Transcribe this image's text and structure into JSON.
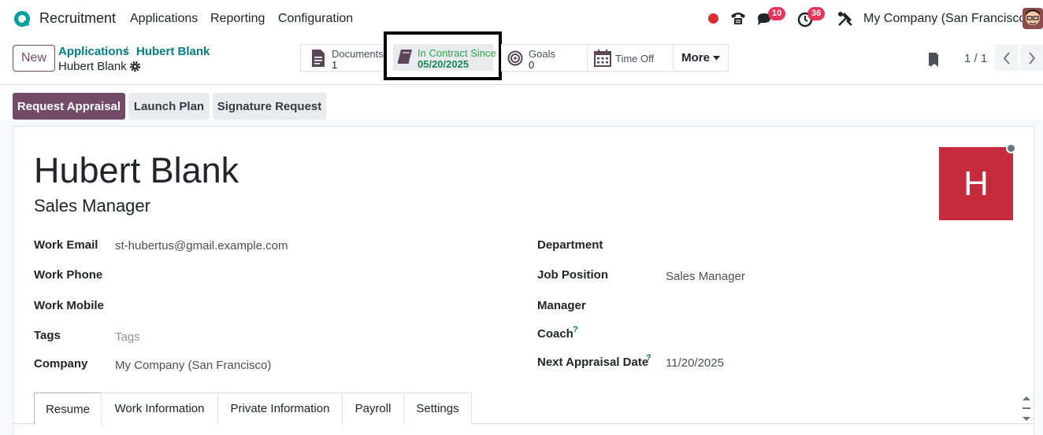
{
  "navbar": {
    "app_name": "Recruitment",
    "menus": [
      "Applications",
      "Reporting",
      "Configuration"
    ],
    "chat_count": "10",
    "activity_count": "36",
    "company": "My Company (San Francisco)"
  },
  "control": {
    "new_label": "New",
    "breadcrumb": [
      "Applications",
      "Hubert Blank"
    ],
    "record_name": "Hubert Blank",
    "smart_buttons": {
      "documents_label": "Documents",
      "documents_value": "1",
      "contract_label": "In Contract Since",
      "contract_value": "05/20/2025",
      "goals_label": "Goals",
      "goals_value": "0",
      "timeoff_label": "Time Off",
      "more_label": "More"
    },
    "pager": "1 / 1"
  },
  "actions": {
    "request_appraisal": "Request Appraisal",
    "launch_plan": "Launch Plan",
    "signature_request": "Signature Request"
  },
  "employee": {
    "name": "Hubert Blank",
    "job_title": "Sales Manager",
    "avatar_letter": "H"
  },
  "fields": {
    "work_email_label": "Work Email",
    "work_email": "st-hubertus@gmail.example.com",
    "work_phone_label": "Work Phone",
    "work_mobile_label": "Work Mobile",
    "tags_label": "Tags",
    "tags_placeholder": "Tags",
    "company_label": "Company",
    "company": "My Company (San Francisco)",
    "department_label": "Department",
    "job_position_label": "Job Position",
    "job_position": "Sales Manager",
    "manager_label": "Manager",
    "coach_label": "Coach",
    "next_appraisal_label": "Next Appraisal Date",
    "next_appraisal": "11/20/2025",
    "help_mark": "?"
  },
  "tabs": [
    "Resume",
    "Work Information",
    "Private Information",
    "Payroll",
    "Settings"
  ],
  "colors": {
    "brand": "#714b67",
    "link": "#017e84",
    "contract_text": "#198754",
    "avatar_bg": "#c52b3d",
    "badge": "#e4345b",
    "recording": "#d62e32"
  },
  "icons": [
    "app-logo-icon",
    "phone-icon",
    "chat-icon",
    "activity-clock-icon",
    "tools-icon",
    "gear-icon",
    "document-icon",
    "book-icon",
    "target-icon",
    "calendar-icon",
    "bookmark-icon",
    "chevron-left-icon",
    "chevron-right-icon"
  ]
}
